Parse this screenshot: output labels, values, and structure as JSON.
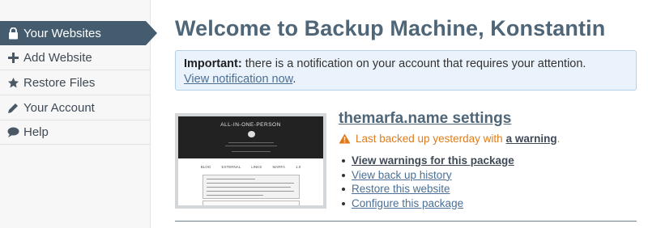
{
  "sidebar": {
    "items": [
      {
        "label": "Your Websites",
        "icon": "lock-icon",
        "active": true
      },
      {
        "label": "Add Website",
        "icon": "plus-icon"
      },
      {
        "label": "Restore Files",
        "icon": "star-icon"
      },
      {
        "label": "Your Account",
        "icon": "pencil-icon"
      },
      {
        "label": "Help",
        "icon": "speech-bubble-icon"
      }
    ]
  },
  "main": {
    "title": "Welcome to Backup Machine, Konstantin",
    "notice": {
      "strong": "Important:",
      "text": " there is a notification on your account that requires your attention.",
      "link": "View notification now",
      "suffix": "."
    },
    "website": {
      "thumbnail": {
        "title": "ALL-IN-ONE-PERSON",
        "nav": "BLOG EXTERNAL LINKS MARFA 1.0"
      },
      "name": "themarfa.name settings",
      "status_text": "Last backed up yesterday with",
      "status_link": "a warning",
      "status_suffix": ".",
      "actions": [
        "View warnings for this package",
        "View back up history",
        "Restore this website",
        "Configure this package"
      ]
    }
  },
  "colors": {
    "sidebar_active": "#445c6e",
    "title": "#4e6678",
    "link": "#4b6f95",
    "warning": "#e07c1b",
    "notice_bg": "#eaf3fb"
  }
}
